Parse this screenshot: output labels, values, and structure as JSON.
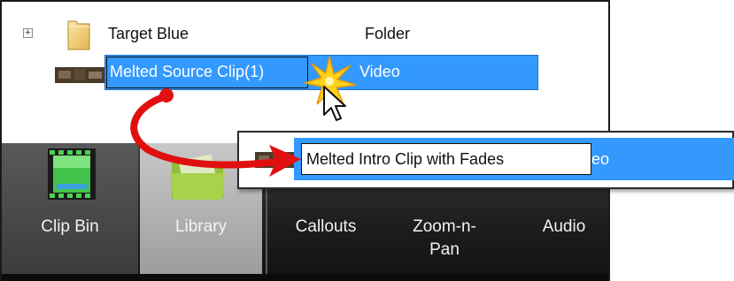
{
  "tree": {
    "folder_row": {
      "expander": "+",
      "name": "Target Blue",
      "type": "Folder",
      "icon": "folder-icon"
    },
    "video_row": {
      "name": "Melted Source Clip(1)",
      "type": "Video",
      "icon": "video-thumbnail-icon"
    }
  },
  "drag_ghost": {
    "name": "Melted Intro Clip with Fades",
    "type_partial": "eo"
  },
  "toolbar": {
    "clip_bin": "Clip Bin",
    "library": "Library",
    "callouts": "Callouts",
    "zoom_n_pan": "Zoom-n-\nPan",
    "audio": "Audio"
  },
  "colors": {
    "selection": "#3399ff",
    "arrow": "#e01010",
    "toolbar_bg": "#1f1f1f",
    "burst": "#ffd21a"
  }
}
